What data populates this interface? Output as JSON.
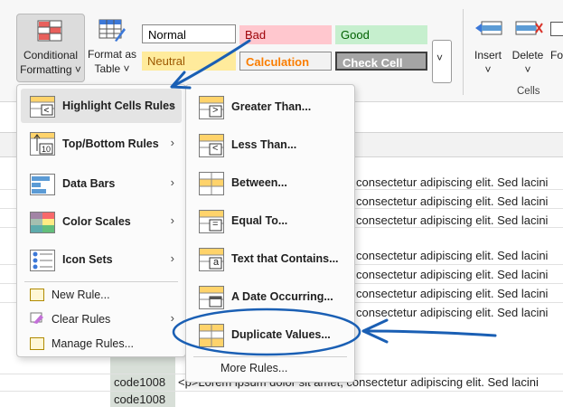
{
  "ribbon": {
    "conditional_formatting": {
      "line1": "Conditional",
      "line2": "Formatting ˅"
    },
    "format_as_table": {
      "line1": "Format as",
      "line2": "Table ˅"
    },
    "styles": {
      "normal": "Normal",
      "bad": "Bad",
      "good": "Good",
      "neutral": "Neutral",
      "calculation": "Calculation",
      "check_cell": "Check Cell"
    },
    "cells_group": {
      "insert": "Insert",
      "insert_caret": "˅",
      "delete": "Delete",
      "delete_caret": "˅",
      "format_partial": "Fo",
      "label": "Cells"
    },
    "colors": {
      "bad_bg": "#ffc7ce",
      "bad_text": "#9c0006",
      "good_bg": "#c6efce",
      "good_text": "#006100",
      "neutral_bg": "#ffeb9c",
      "neutral_text": "#9c5700",
      "calc_text": "#fa7d00",
      "check_bg": "#a5a5a5"
    }
  },
  "sheet": {
    "rows": [
      "consectetur adipiscing elit. Sed lacini",
      "consectetur adipiscing elit. Sed lacini",
      "consectetur adipiscing elit. Sed lacini",
      "consectetur adipiscing elit. Sed lacini",
      "consectetur adipiscing elit. Sed lacini",
      "consectetur adipiscing elit. Sed lacini",
      "consectetur adipiscing elit. Sed lacini"
    ],
    "code_cells": [
      "code1008",
      "code1008"
    ],
    "lorem_cell": "<p>Lorem ipsum dolor sit amet, consectetur adipiscing elit. Sed lacini"
  },
  "main_menu": {
    "items": [
      {
        "label": "Highlight Cells Rules",
        "icon": "highlight-cells-icon"
      },
      {
        "label": "Top/Bottom Rules",
        "icon": "top-bottom-icon"
      },
      {
        "label": "Data Bars",
        "icon": "data-bars-icon"
      },
      {
        "label": "Color Scales",
        "icon": "color-scales-icon"
      },
      {
        "label": "Icon Sets",
        "icon": "icon-sets-icon"
      }
    ],
    "small_items": [
      {
        "label": "New Rule...",
        "icon": "new-rule-icon"
      },
      {
        "label": "Clear Rules",
        "icon": "clear-rules-icon"
      },
      {
        "label": "Manage Rules...",
        "icon": "manage-rules-icon"
      }
    ]
  },
  "submenu": {
    "items": [
      {
        "label": "Greater Than...",
        "symbol": ">"
      },
      {
        "label": "Less Than...",
        "symbol": "<"
      },
      {
        "label": "Between...",
        "symbol": ""
      },
      {
        "label": "Equal To...",
        "symbol": "="
      },
      {
        "label": "Text that Contains...",
        "symbol": "a"
      },
      {
        "label": "A Date Occurring...",
        "symbol": ""
      },
      {
        "label": "Duplicate Values...",
        "symbol": ""
      }
    ],
    "more_rules": "More Rules...",
    "icon_badge_10": "10",
    "chevron": "›"
  }
}
